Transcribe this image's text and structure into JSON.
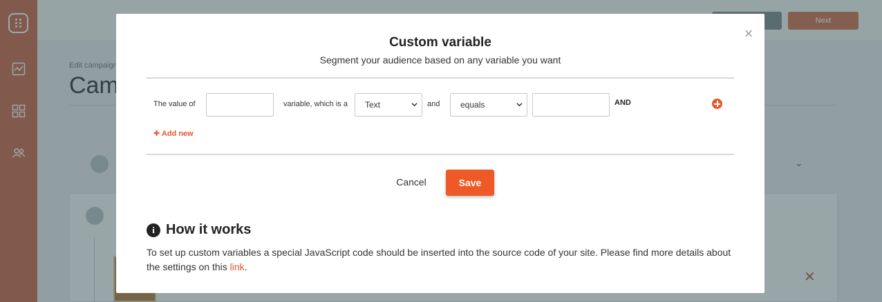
{
  "background": {
    "edit_label": "Edit campaign",
    "title": "Cam",
    "next_button": "Next"
  },
  "modal": {
    "title": "Custom variable",
    "subtitle": "Segment your audience based on any variable you want",
    "close_icon": "close-icon",
    "condition": {
      "prefix": "The value of",
      "variable_value": "",
      "middle_text": "variable, which is a",
      "type_selected": "Text",
      "and_text": "and",
      "operator_selected": "equals",
      "compare_value": "",
      "and_label": "AND"
    },
    "add_new": "Add new",
    "cancel_label": "Cancel",
    "save_label": "Save",
    "how": {
      "title": "How it works",
      "text": "To set up custom variables a special JavaScript code should be inserted into the source code of your site. Please find more details about the settings on this ",
      "link": "link",
      "suffix": "."
    }
  },
  "colors": {
    "accent": "#ed5a27",
    "sidebar": "#c9664a"
  }
}
